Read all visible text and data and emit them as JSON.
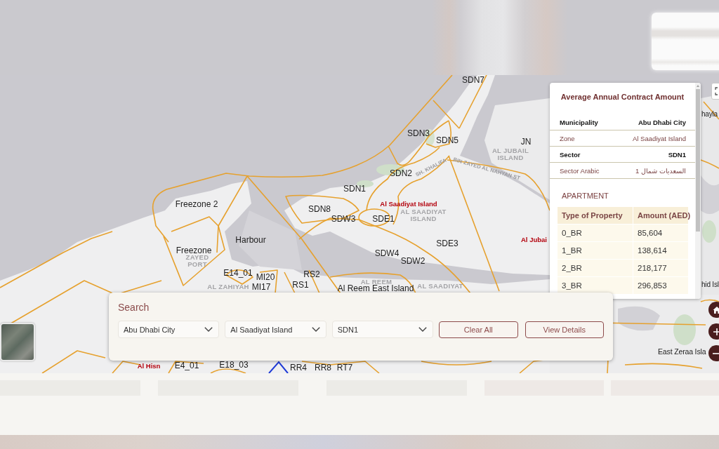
{
  "map": {
    "labels": [
      {
        "text": "SDN7",
        "kind": "sector"
      },
      {
        "text": "SDN3",
        "kind": "sector"
      },
      {
        "text": "SDN5",
        "kind": "sector"
      },
      {
        "text": "JN",
        "kind": "sector"
      },
      {
        "text": "AL JUBAIL ISLAND",
        "kind": "area"
      },
      {
        "text": "SDN2",
        "kind": "sector"
      },
      {
        "text": "SH. KHALIFA",
        "kind": "road"
      },
      {
        "text": "BIN ZAYED AL NAHYAN ST",
        "kind": "road"
      },
      {
        "text": "SDN1",
        "kind": "sector"
      },
      {
        "text": "Freezone 2",
        "kind": "sector"
      },
      {
        "text": "Al Saadiyat Island",
        "kind": "place"
      },
      {
        "text": "SDN8",
        "kind": "sector"
      },
      {
        "text": "SDW3",
        "kind": "sector"
      },
      {
        "text": "SDE1",
        "kind": "sector"
      },
      {
        "text": "AL SAADIYAT ISLAND",
        "kind": "area"
      },
      {
        "text": "Harbour",
        "kind": "sector"
      },
      {
        "text": "SDE3",
        "kind": "sector"
      },
      {
        "text": "Al Jubai",
        "kind": "place"
      },
      {
        "text": "Freezone",
        "kind": "sector"
      },
      {
        "text": "ZAYED PORT",
        "kind": "area"
      },
      {
        "text": "SDW4",
        "kind": "sector"
      },
      {
        "text": "SDW2",
        "kind": "sector"
      },
      {
        "text": "E14_01",
        "kind": "sector"
      },
      {
        "text": "MI20",
        "kind": "sector"
      },
      {
        "text": "RS2",
        "kind": "sector"
      },
      {
        "text": "AL ZAHIYAH",
        "kind": "area"
      },
      {
        "text": "MI17",
        "kind": "sector"
      },
      {
        "text": "RS1",
        "kind": "sector"
      },
      {
        "text": "AL REEM",
        "kind": "area"
      },
      {
        "text": "Al Reem East Island",
        "kind": "sector"
      },
      {
        "text": "AL SAADIYAT",
        "kind": "area"
      },
      {
        "text": "hayla",
        "kind": "sector"
      },
      {
        "text": "hid Isl",
        "kind": "sector"
      },
      {
        "text": "Al Hisn",
        "kind": "place"
      },
      {
        "text": "E4_01",
        "kind": "sector"
      },
      {
        "text": "E18_03",
        "kind": "sector"
      },
      {
        "text": "RR4",
        "kind": "sector"
      },
      {
        "text": "RR8",
        "kind": "sector"
      },
      {
        "text": "RT7",
        "kind": "sector"
      },
      {
        "text": "East Zeraa Isla",
        "kind": "sector"
      }
    ]
  },
  "info_popup": {
    "title": "Average Annual Contract Amount",
    "attributes": [
      {
        "label": "Municipality",
        "value": "Abu Dhabi City"
      },
      {
        "label": "Zone",
        "value": "Al Saadiyat Island"
      },
      {
        "label": "Sector",
        "value": "SDN1"
      },
      {
        "label": "Sector Arabic",
        "value": "السعديات شمال 1"
      }
    ],
    "section": "APARTMENT",
    "table": {
      "columns": [
        "Type of Property",
        "Amount (AED)"
      ],
      "rows": [
        [
          "0_BR",
          "85,604"
        ],
        [
          "1_BR",
          "138,614"
        ],
        [
          "2_BR",
          "218,177"
        ],
        [
          "3_BR",
          "296,853"
        ]
      ]
    }
  },
  "search_panel": {
    "title": "Search",
    "dropdowns": [
      {
        "value": "Abu Dhabi City"
      },
      {
        "value": "Al Saadiyat Island"
      },
      {
        "value": "SDN1"
      }
    ],
    "buttons": [
      "Clear All",
      "View Details"
    ]
  }
}
